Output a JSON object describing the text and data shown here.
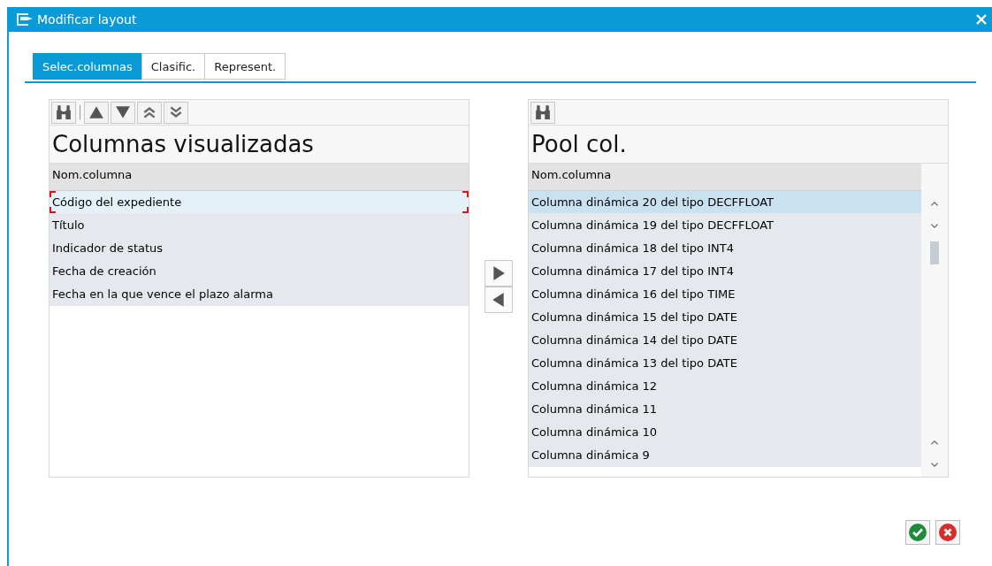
{
  "window": {
    "title": "Modificar layout"
  },
  "tabs": [
    {
      "label": "Selec.columnas",
      "selected": true
    },
    {
      "label": "Clasific.",
      "selected": false
    },
    {
      "label": "Represent.",
      "selected": false
    }
  ],
  "displayed_columns": {
    "title": "Columnas visualizadas",
    "header": "Nom.columna",
    "rows": [
      {
        "label": "Código del expediente",
        "selected": true
      },
      {
        "label": "Título",
        "selected": false
      },
      {
        "label": "Indicador de status",
        "selected": false
      },
      {
        "label": "Fecha de creación",
        "selected": false
      },
      {
        "label": "Fecha en la que vence el plazo alarma",
        "selected": false
      }
    ]
  },
  "column_pool": {
    "title": "Pool col.",
    "header": "Nom.columna",
    "rows": [
      {
        "label": "Columna dinámica 20 del tipo DECFFLOAT",
        "selected": true
      },
      {
        "label": "Columna dinámica 19 del tipo DECFFLOAT",
        "selected": false
      },
      {
        "label": "Columna dinámica 18 del tipo INT4",
        "selected": false
      },
      {
        "label": "Columna dinámica 17 del tipo INT4",
        "selected": false
      },
      {
        "label": "Columna dinámica 16 del tipo TIME",
        "selected": false
      },
      {
        "label": "Columna dinámica 15 del tipo DATE",
        "selected": false
      },
      {
        "label": "Columna dinámica 14 del tipo DATE",
        "selected": false
      },
      {
        "label": "Columna dinámica 13 del tipo DATE",
        "selected": false
      },
      {
        "label": "Columna dinámica 12",
        "selected": false
      },
      {
        "label": "Columna dinámica 11",
        "selected": false
      },
      {
        "label": "Columna dinámica 10",
        "selected": false
      },
      {
        "label": "Columna dinámica 9",
        "selected": false
      }
    ]
  }
}
